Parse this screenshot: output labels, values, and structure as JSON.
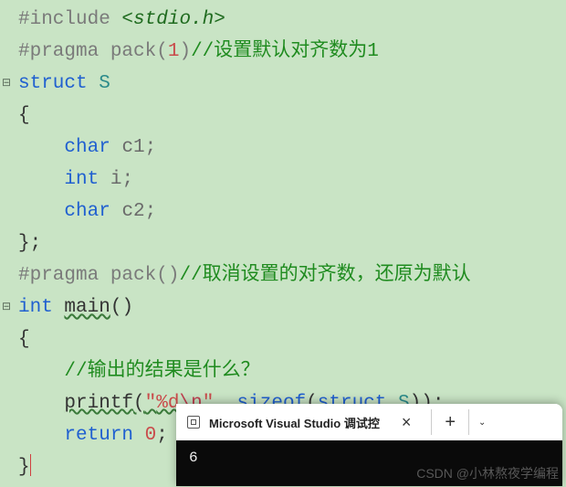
{
  "code": {
    "line1_directive": "#include",
    "line1_open": " <",
    "line1_lib": "stdio.h",
    "line1_close": ">",
    "line2_directive": "#pragma pack",
    "line2_paren_open": "(",
    "line2_num": "1",
    "line2_paren_close": ")",
    "line2_comment": "//设置默认对齐数为1",
    "line3_struct": "struct",
    "line3_name": " S",
    "line4_brace": "{",
    "line5_indent": "    ",
    "line5_type": "char",
    "line5_var": " c1;",
    "line6_indent": "    ",
    "line6_type": "int",
    "line6_var": " i;",
    "line7_indent": "    ",
    "line7_type": "char",
    "line7_var": " c2;",
    "line8_brace": "};",
    "line9_directive": "#pragma pack",
    "line9_parens": "()",
    "line9_comment": "//取消设置的对齐数，还原为默认",
    "line10_type": "int",
    "line10_space": " ",
    "line10_main": "main",
    "line10_parens": "()",
    "line11_brace": "{",
    "line12_indent": "    ",
    "line12_comment": "//输出的结果是什么？",
    "line13_indent": "    ",
    "line13_printf": "printf",
    "line13_open": "(",
    "line13_str_open": "\"",
    "line13_str_fmt": "%d",
    "line13_str_esc": "\\n",
    "line13_str_close": "\"",
    "line13_comma": ", ",
    "line13_sizeof": "sizeof",
    "line13_sz_open": "(",
    "line13_sz_struct": "struct",
    "line13_sz_name": " S",
    "line13_sz_close": "));",
    "line14_indent": "    ",
    "line14_return": "return",
    "line14_space": " ",
    "line14_zero": "0",
    "line14_semi": ";",
    "line15_brace": "}"
  },
  "fold_marker": "⊟",
  "terminal": {
    "tab_title": "Microsoft Visual Studio 调试控",
    "close": "×",
    "new_tab": "+",
    "expand": "⌄",
    "output": "6"
  },
  "watermark": "CSDN @小林熬夜学编程"
}
